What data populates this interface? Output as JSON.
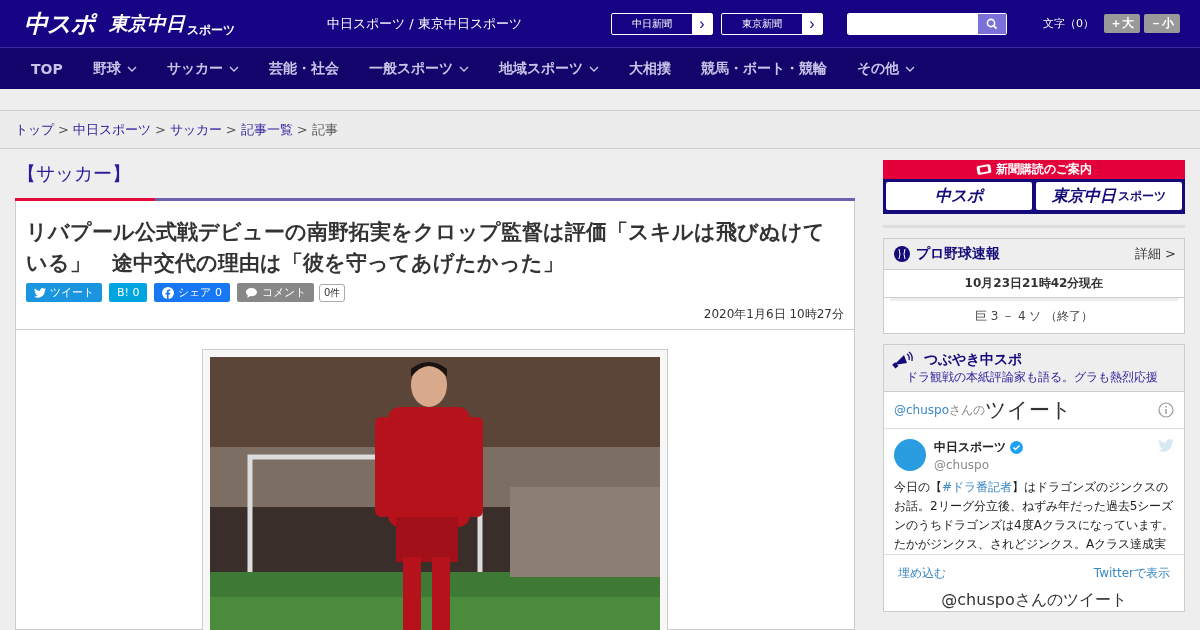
{
  "header": {
    "logo_main": "中スポ",
    "logo_sub": "東京中日",
    "logo_sub_small": "スポーツ",
    "site_name": "中日スポーツ / 東京中日スポーツ",
    "paper_links": [
      "中日新聞",
      "東京新聞"
    ],
    "link_arrow": "›",
    "font_size": {
      "label": "文字（0）",
      "buttons": [
        "＋大",
        "－小"
      ]
    }
  },
  "nav": [
    {
      "label": "TOP",
      "has_menu": false
    },
    {
      "label": "野球",
      "has_menu": true
    },
    {
      "label": "サッカー",
      "has_menu": true
    },
    {
      "label": "芸能・社会",
      "has_menu": false
    },
    {
      "label": "一般スポーツ",
      "has_menu": true
    },
    {
      "label": "地域スポーツ",
      "has_menu": true
    },
    {
      "label": "大相撲",
      "has_menu": false
    },
    {
      "label": "競馬・ボート・競輪",
      "has_menu": false
    },
    {
      "label": "その他",
      "has_menu": true
    }
  ],
  "breadcrumb": [
    {
      "label": "トップ",
      "link": true
    },
    {
      "label": "中日スポーツ",
      "link": true
    },
    {
      "label": "サッカー",
      "link": true
    },
    {
      "label": "記事一覧",
      "link": true
    },
    {
      "label": "記事",
      "link": false
    }
  ],
  "breadcrumb_sep": ">",
  "article": {
    "category": "【サッカー】",
    "title": "リバプール公式戦デビューの南野拓実をクロップ監督は評価「スキルは飛びぬけている」　途中交代の理由は「彼を守ってあげたかった」",
    "share": [
      {
        "kind": "twitter",
        "label": "ツイート"
      },
      {
        "kind": "hatena",
        "label": "B! 0"
      },
      {
        "kind": "facebook",
        "label": "シェア 0"
      },
      {
        "kind": "comment",
        "label": "コメント"
      }
    ],
    "comment_count": "0件",
    "date": "2020年1月6日 10時27分"
  },
  "sidebar": {
    "subscribe": {
      "title": "新聞購読のご案内",
      "papers": [
        {
          "main": "中スポ"
        },
        {
          "main": "東京中日",
          "small": "スポーツ"
        }
      ]
    },
    "baseball": {
      "title": "プロ野球速報",
      "detail": "詳細 >",
      "time": "10月23日21時42分現在",
      "score": "巨 3 － 4 ソ （終了）"
    },
    "tweets": {
      "title": "つぶやき中スポ",
      "subtitle": "ドラ観戦の本紙評論家も語る。グラも熱烈応援",
      "handle": "@chuspo",
      "handle_suffix": "さんの",
      "heading": "ツイート",
      "account": "中日スポーツ",
      "account_handle": "@chuspo",
      "text_before": "今日の【",
      "hashtag": "#ドラ番記者",
      "text_after": "】はドラゴンズのジンクスのお話。2リーグ分立後、ねずみ年だった過去5シーズンのうちドラゴンズは4度Aクラスになっています。たかがジンクス、されどジンクス。Aクラス達成実",
      "embed": "埋め込む",
      "view": "Twitterで表示",
      "footer": "@chuspoさんのツイート"
    }
  }
}
